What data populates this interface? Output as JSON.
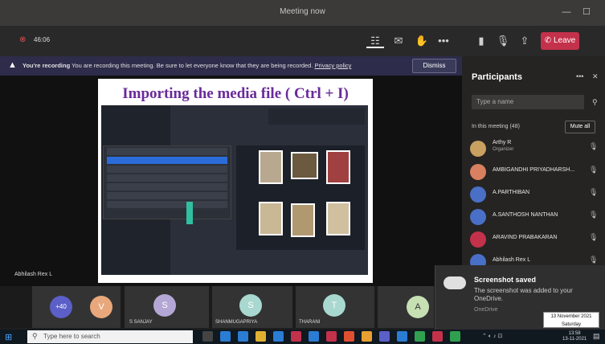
{
  "window": {
    "title": "Meeting now"
  },
  "meeting": {
    "timer": "46:06",
    "leave_label": "Leave"
  },
  "recording": {
    "prefix": "You're recording",
    "message": "You are recording this meeting. Be sure to let everyone know that they are being recorded.",
    "privacy_link": "Privacy policy",
    "dismiss_label": "Dismiss"
  },
  "slide": {
    "title": "Importing the media file ( Ctrl + I)"
  },
  "presenter": {
    "name": "Abhilash Rex L"
  },
  "participants": {
    "header": "Participants",
    "search_placeholder": "Type a name",
    "in_meeting_label": "In this meeting (48)",
    "mute_all_label": "Mute all",
    "list": [
      {
        "initials": "",
        "name": "Arthy R",
        "subtitle": "Organizer",
        "color": "#c8a060"
      },
      {
        "initials": "",
        "name": "AMBIGANDHI PRIYADHARSH...",
        "subtitle": "",
        "color": "#d98060"
      },
      {
        "initials": "",
        "name": "A.PARTHIBAN",
        "subtitle": "",
        "color": "#4a6fc7"
      },
      {
        "initials": "",
        "name": "A.SANTHOSH NANTHAN",
        "subtitle": "",
        "color": "#4a6fc7"
      },
      {
        "initials": "",
        "name": "ARAVIND PRABAKARAN",
        "subtitle": "",
        "color": "#c4314b"
      },
      {
        "initials": "",
        "name": "Abhilash Rex L",
        "subtitle": "",
        "color": "#4a6fc7"
      }
    ]
  },
  "gallery": [
    {
      "initials": "+40",
      "name": "",
      "color": "#5b5fc7"
    },
    {
      "initials": "V",
      "name": "",
      "color": "#e8a87c"
    },
    {
      "initials": "S",
      "name": "S SANJAY",
      "color": "#b4a7d6"
    },
    {
      "initials": "S",
      "name": "SHANMUGAPRIYA",
      "color": "#a8d8cf"
    },
    {
      "initials": "T",
      "name": "THARANI",
      "color": "#a8d8cf"
    },
    {
      "initials": "A",
      "name": "",
      "color": "#c6e0b4"
    }
  ],
  "toast": {
    "title": "Screenshot saved",
    "body": "The screenshot was added to your OneDrive.",
    "app": "OneDrive"
  },
  "datetip": "13 November 2021 Saturday",
  "taskbar": {
    "search_placeholder": "Type here to search",
    "time": "13:58",
    "date": "13-11-2021"
  }
}
